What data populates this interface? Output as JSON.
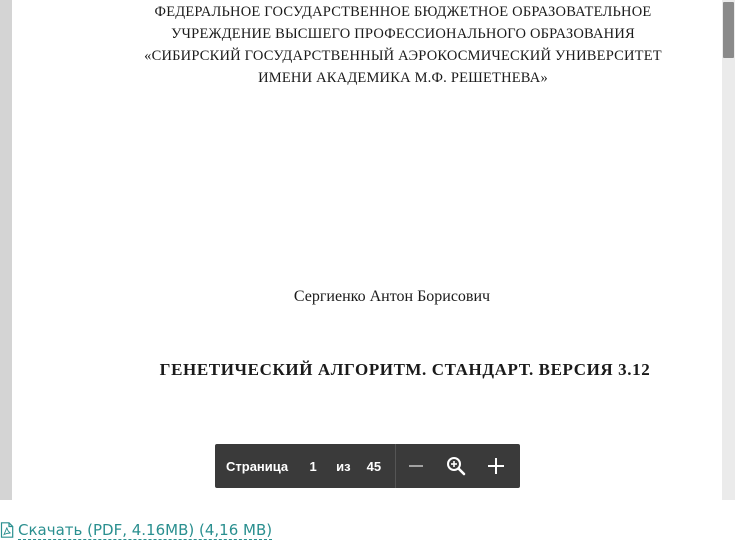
{
  "document": {
    "org_lines": [
      "ФЕДЕРАЛЬНОЕ ГОСУДАРСТВЕННОЕ БЮДЖЕТНОЕ ОБРАЗОВАТЕЛЬНОЕ",
      "УЧРЕЖДЕНИЕ ВЫСШЕГО ПРОФЕССИОНАЛЬНОГО ОБРАЗОВАНИЯ",
      "«СИБИРСКИЙ ГОСУДАРСТВЕННЫЙ АЭРОКОСМИЧЕСКИЙ УНИВЕРСИТЕТ",
      "ИМЕНИ АКАДЕМИКА М.Ф. РЕШЕТНЕВА»"
    ],
    "author": "Сергиенко Антон Борисович",
    "title": "ГЕНЕТИЧЕСКИЙ АЛГОРИТМ. СТАНДАРТ. ВЕРСИЯ 3.12"
  },
  "toolbar": {
    "page_label": "Страница",
    "current_page": "1",
    "of_label": "из",
    "total_pages": "45",
    "icons": [
      "minus-icon",
      "zoom-icon",
      "plus-icon"
    ]
  },
  "download": {
    "label": "Скачать (PDF, 4.16MB) (4,16 MB)",
    "icon": "pdf-file-icon",
    "color": "#2a8f8f"
  },
  "colors": {
    "viewer_bg": "#d4d4d4",
    "toolbar_bg": "#3a3a3a"
  }
}
